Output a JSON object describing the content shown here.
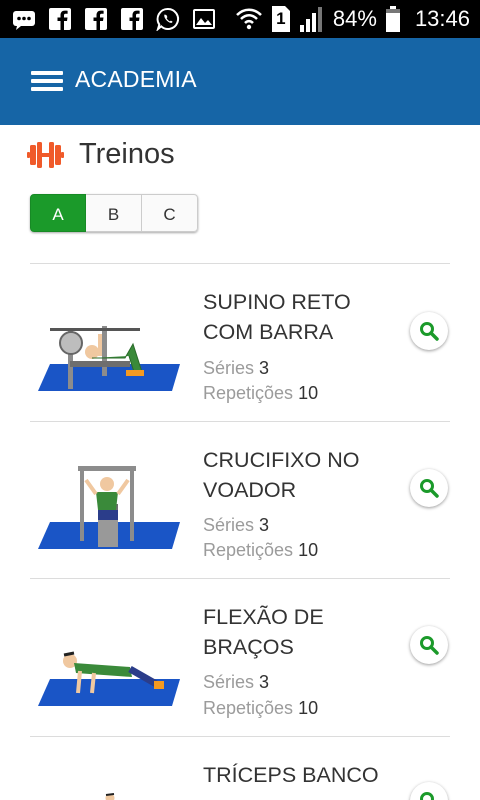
{
  "status_bar": {
    "battery_percent": "84%",
    "time": "13:46",
    "sim_slot": "1",
    "notification_icons": [
      "chat-icon",
      "facebook-icon",
      "facebook-icon",
      "facebook-icon",
      "whatsapp-icon",
      "image-icon"
    ],
    "system_icons": [
      "wifi-icon",
      "sim-icon",
      "signal-icon",
      "battery-icon"
    ]
  },
  "app_bar": {
    "title": "ACADEMIA",
    "color": "#1665a6"
  },
  "section": {
    "icon": "dumbbell-icon",
    "title": "Treinos"
  },
  "tabs": {
    "items": [
      "A",
      "B",
      "C"
    ],
    "selected": "A",
    "active_color": "#1b9a2a"
  },
  "exercises": [
    {
      "name": "SUPINO RETO COM BARRA",
      "series_label": "Séries",
      "series": "3",
      "reps_label": "Repetições",
      "reps": "10"
    },
    {
      "name": "CRUCIFIXO NO VOADOR",
      "series_label": "Séries",
      "series": "3",
      "reps_label": "Repetições",
      "reps": "10"
    },
    {
      "name": "FLEXÃO DE BRAÇOS",
      "series_label": "Séries",
      "series": "3",
      "reps_label": "Repetições",
      "reps": "10"
    },
    {
      "name": "TRÍCEPS BANCO"
    }
  ]
}
